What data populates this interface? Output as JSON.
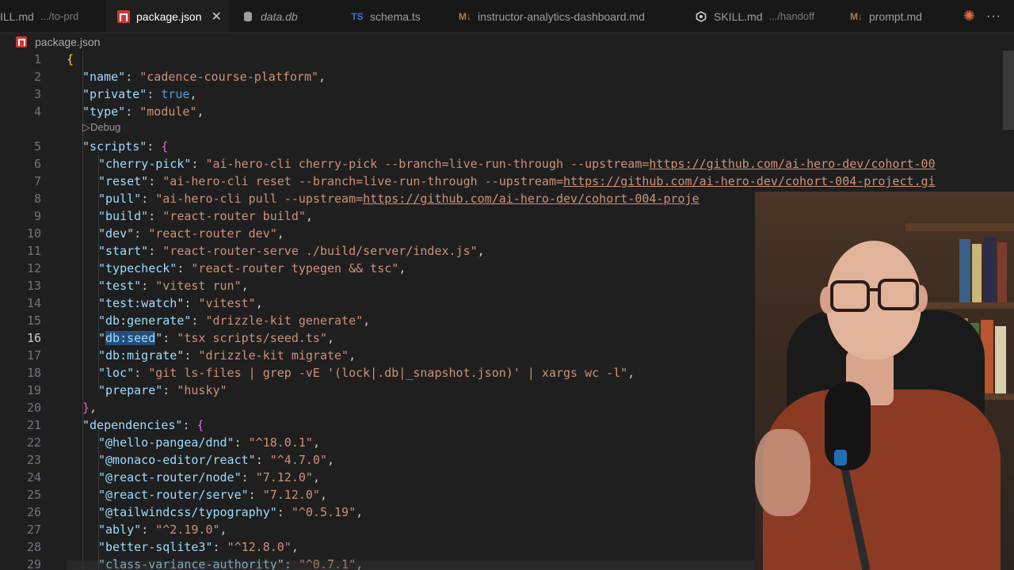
{
  "tabs": [
    {
      "name": "ILL.md",
      "dir": ".../to-prd",
      "icon": "markdown-icon",
      "active": false,
      "italic": false
    },
    {
      "name": "package.json",
      "dir": "",
      "icon": "npm-icon",
      "active": true,
      "italic": false
    },
    {
      "name": "data.db",
      "dir": "",
      "icon": "database-icon",
      "active": false,
      "italic": true
    },
    {
      "name": "schema.ts",
      "dir": "",
      "icon": "typescript-icon",
      "active": false,
      "italic": false
    },
    {
      "name": "instructor-analytics-dashboard.md",
      "dir": "",
      "icon": "markdown-icon",
      "active": false,
      "italic": false
    },
    {
      "name": "SKILL.md",
      "dir": ".../handoff",
      "icon": "skill-icon",
      "active": false,
      "italic": false
    },
    {
      "name": "prompt.md",
      "dir": "",
      "icon": "markdown-icon",
      "active": false,
      "italic": false
    }
  ],
  "breadcrumb": {
    "file": "package.json"
  },
  "codelens": "▷Debug",
  "editor": {
    "current_line": 16,
    "lines": [
      {
        "n": "1",
        "text": "{"
      },
      {
        "n": "2",
        "text": "\"name\": \"cadence-course-platform\","
      },
      {
        "n": "3",
        "text": "\"private\": true,"
      },
      {
        "n": "4",
        "text": "\"type\": \"module\","
      },
      {
        "n": "5",
        "text": "\"scripts\": {"
      },
      {
        "n": "6",
        "text": "\"cherry-pick\": \"ai-hero-cli cherry-pick --branch=live-run-through --upstream=https://github.com/ai-hero-dev/cohort-00"
      },
      {
        "n": "7",
        "text": "\"reset\": \"ai-hero-cli reset --branch=live-run-through --upstream=https://github.com/ai-hero-dev/cohort-004-project.gi"
      },
      {
        "n": "8",
        "text": "\"pull\": \"ai-hero-cli pull --upstream=https://github.com/ai-hero-dev/cohort-004-proje"
      },
      {
        "n": "9",
        "text": "\"build\": \"react-router build\","
      },
      {
        "n": "10",
        "text": "\"dev\": \"react-router dev\","
      },
      {
        "n": "11",
        "text": "\"start\": \"react-router-serve ./build/server/index.js\","
      },
      {
        "n": "12",
        "text": "\"typecheck\": \"react-router typegen && tsc\","
      },
      {
        "n": "13",
        "text": "\"test\": \"vitest run\","
      },
      {
        "n": "14",
        "text": "\"test:watch\": \"vitest\","
      },
      {
        "n": "15",
        "text": "\"db:generate\": \"drizzle-kit generate\","
      },
      {
        "n": "16",
        "text": "\"db:seed\": \"tsx scripts/seed.ts\","
      },
      {
        "n": "17",
        "text": "\"db:migrate\": \"drizzle-kit migrate\","
      },
      {
        "n": "18",
        "text": "\"loc\": \"git ls-files | grep -vE '(lock|.db|_snapshot.json)' | xargs wc -l\","
      },
      {
        "n": "19",
        "text": "\"prepare\": \"husky\""
      },
      {
        "n": "20",
        "text": "},"
      },
      {
        "n": "21",
        "text": "\"dependencies\": {"
      },
      {
        "n": "22",
        "text": "\"@hello-pangea/dnd\": \"^18.0.1\","
      },
      {
        "n": "23",
        "text": "\"@monaco-editor/react\": \"^4.7.0\","
      },
      {
        "n": "24",
        "text": "\"@react-router/node\": \"7.12.0\","
      },
      {
        "n": "25",
        "text": "\"@react-router/serve\": \"7.12.0\","
      },
      {
        "n": "26",
        "text": "\"@tailwindcss/typography\": \"^0.5.19\","
      },
      {
        "n": "27",
        "text": "\"ably\": \"^2.19.0\","
      },
      {
        "n": "28",
        "text": "\"better-sqlite3\": \"^12.8.0\","
      },
      {
        "n": "29",
        "text": "\"class-variance-authority\": \"^0.7.1\","
      }
    ]
  },
  "colors": {
    "editor_bg": "#1f1f1f",
    "key": "#9cdcfe",
    "string": "#ce9178",
    "keyword": "#569cd6",
    "brace_outer": "#ffd700",
    "brace_inner": "#da70d6"
  }
}
